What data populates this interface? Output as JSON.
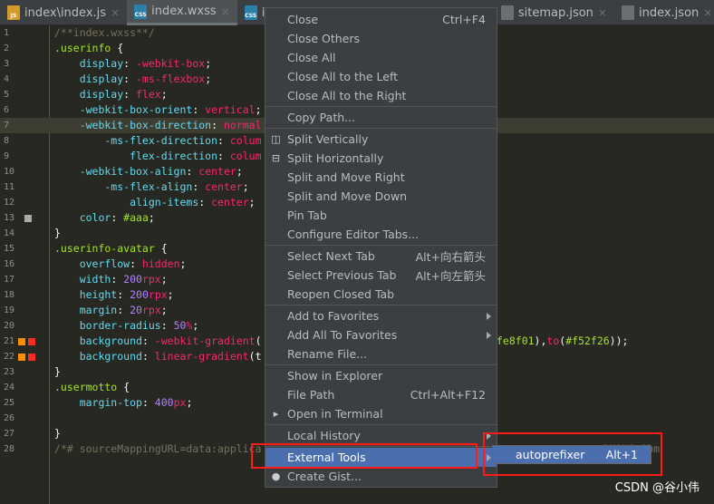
{
  "tabs": [
    {
      "label": "index\\index.js",
      "icon": "js-file-icon",
      "badge": "JS",
      "active": false
    },
    {
      "label": "index.wxss",
      "icon": "css-file-icon",
      "badge": "CSS",
      "active": true
    },
    {
      "label": "ind",
      "icon": "css-file-icon",
      "badge": "CSS",
      "active": false
    },
    {
      "label": "sitemap.json",
      "icon": "json-file-icon",
      "badge": "",
      "active": false
    },
    {
      "label": "index.json",
      "icon": "json-file-icon",
      "badge": "",
      "active": false
    }
  ],
  "editor": {
    "current_line": 7,
    "lines": [
      {
        "n": "1",
        "seg": [
          [
            "comment",
            "/**index.wxss**/"
          ]
        ]
      },
      {
        "n": "2",
        "seg": [
          [
            "sel",
            ".userinfo "
          ],
          [
            "p",
            "{"
          ]
        ]
      },
      {
        "n": "3",
        "seg": [
          [
            "prop",
            "    display"
          ],
          [
            "p",
            ": "
          ],
          [
            "val",
            "-webkit-box"
          ],
          [
            "p",
            ";"
          ]
        ]
      },
      {
        "n": "4",
        "seg": [
          [
            "prop",
            "    display"
          ],
          [
            "p",
            ": "
          ],
          [
            "val",
            "-ms-flexbox"
          ],
          [
            "p",
            ";"
          ]
        ]
      },
      {
        "n": "5",
        "seg": [
          [
            "prop",
            "    display"
          ],
          [
            "p",
            ": "
          ],
          [
            "val",
            "flex"
          ],
          [
            "p",
            ";"
          ]
        ]
      },
      {
        "n": "6",
        "seg": [
          [
            "prop",
            "    -webkit-box-orient"
          ],
          [
            "p",
            ": "
          ],
          [
            "val",
            "vertical"
          ],
          [
            "p",
            ";"
          ]
        ]
      },
      {
        "n": "7",
        "seg": [
          [
            "prop",
            "    -webkit-box-direction"
          ],
          [
            "p",
            ": "
          ],
          [
            "val",
            "normal"
          ]
        ]
      },
      {
        "n": "8",
        "seg": [
          [
            "prop",
            "        -ms-flex-direction"
          ],
          [
            "p",
            ": "
          ],
          [
            "val",
            "colum"
          ]
        ]
      },
      {
        "n": "9",
        "seg": [
          [
            "prop",
            "            flex-direction"
          ],
          [
            "p",
            ": "
          ],
          [
            "val",
            "colum"
          ]
        ]
      },
      {
        "n": "10",
        "seg": [
          [
            "prop",
            "    -webkit-box-align"
          ],
          [
            "p",
            ": "
          ],
          [
            "val",
            "center"
          ],
          [
            "p",
            ";"
          ]
        ]
      },
      {
        "n": "11",
        "seg": [
          [
            "prop",
            "        -ms-flex-align"
          ],
          [
            "p",
            ": "
          ],
          [
            "val",
            "center"
          ],
          [
            "p",
            ";"
          ]
        ]
      },
      {
        "n": "12",
        "seg": [
          [
            "prop",
            "            align-items"
          ],
          [
            "p",
            ": "
          ],
          [
            "val",
            "center"
          ],
          [
            "p",
            ";"
          ]
        ]
      },
      {
        "n": "13",
        "seg": [
          [
            "prop",
            "    color"
          ],
          [
            "p",
            ": "
          ],
          [
            "sel",
            "#aaa"
          ],
          [
            "p",
            ";"
          ]
        ],
        "marks": [
          "#aaaaaa"
        ]
      },
      {
        "n": "14",
        "seg": [
          [
            "p",
            "}"
          ]
        ]
      },
      {
        "n": "15",
        "seg": [
          [
            "sel",
            ".userinfo-avatar "
          ],
          [
            "p",
            "{"
          ]
        ]
      },
      {
        "n": "16",
        "seg": [
          [
            "prop",
            "    overflow"
          ],
          [
            "p",
            ": "
          ],
          [
            "val",
            "hidden"
          ],
          [
            "p",
            ";"
          ]
        ]
      },
      {
        "n": "17",
        "seg": [
          [
            "prop",
            "    width"
          ],
          [
            "p",
            ": "
          ],
          [
            "num",
            "200"
          ],
          [
            "val",
            "rpx"
          ],
          [
            "p",
            ";"
          ]
        ]
      },
      {
        "n": "18",
        "seg": [
          [
            "prop",
            "    height"
          ],
          [
            "p",
            ": "
          ],
          [
            "num",
            "200"
          ],
          [
            "val",
            "rpx"
          ],
          [
            "p",
            ";"
          ]
        ]
      },
      {
        "n": "19",
        "seg": [
          [
            "prop",
            "    margin"
          ],
          [
            "p",
            ": "
          ],
          [
            "num",
            "20"
          ],
          [
            "val",
            "rpx"
          ],
          [
            "p",
            ";"
          ]
        ]
      },
      {
        "n": "20",
        "seg": [
          [
            "prop",
            "    border-radius"
          ],
          [
            "p",
            ": "
          ],
          [
            "num",
            "50"
          ],
          [
            "val",
            "%"
          ],
          [
            "p",
            ";"
          ]
        ]
      },
      {
        "n": "21",
        "seg": [
          [
            "prop",
            "    background"
          ],
          [
            "p",
            ": "
          ],
          [
            "val",
            "-webkit-gradient"
          ],
          [
            "p",
            "("
          ]
        ],
        "tail": [
          [
            "sel",
            "fe8f01"
          ],
          [
            "p",
            "),"
          ],
          [
            "val",
            "to"
          ],
          [
            "p",
            "("
          ],
          [
            "sel",
            "#f52f26"
          ],
          [
            "p",
            "));"
          ]
        ],
        "marks": [
          "#fe8f01",
          "#f52f26"
        ]
      },
      {
        "n": "22",
        "seg": [
          [
            "prop",
            "    background"
          ],
          [
            "p",
            ": "
          ],
          [
            "val",
            "linear-gradient"
          ],
          [
            "p",
            "(t"
          ]
        ],
        "marks": [
          "#fe8f01",
          "#f52f26"
        ]
      },
      {
        "n": "23",
        "seg": [
          [
            "p",
            "}"
          ]
        ]
      },
      {
        "n": "24",
        "seg": [
          [
            "sel",
            ".usermotto "
          ],
          [
            "p",
            "{"
          ]
        ]
      },
      {
        "n": "25",
        "seg": [
          [
            "prop",
            "    margin-top"
          ],
          [
            "p",
            ": "
          ],
          [
            "num",
            "400"
          ],
          [
            "val",
            "px"
          ],
          [
            "p",
            ";"
          ]
        ]
      },
      {
        "n": "26",
        "seg": []
      },
      {
        "n": "27",
        "seg": [
          [
            "p",
            "}"
          ]
        ]
      },
      {
        "n": "28",
        "seg": [
          [
            "comment",
            "/*# sourceMappingURL=data:applica"
          ]
        ],
        "tail": [
          [
            "comment",
            "                c3MiXSwibm"
          ]
        ]
      }
    ]
  },
  "context_menu": {
    "items": [
      {
        "label": "Close",
        "shortcut": "Ctrl+F4"
      },
      {
        "label": "Close Others"
      },
      {
        "label": "Close All"
      },
      {
        "label": "Close All to the Left"
      },
      {
        "label": "Close All to the Right"
      },
      {
        "sep": true
      },
      {
        "label": "Copy Path..."
      },
      {
        "sep": true
      },
      {
        "label": "Split Vertically",
        "icon": "split-vertical-icon"
      },
      {
        "label": "Split Horizontally",
        "icon": "split-horizontal-icon"
      },
      {
        "label": "Split and Move Right"
      },
      {
        "label": "Split and Move Down"
      },
      {
        "label": "Pin Tab"
      },
      {
        "label": "Configure Editor Tabs..."
      },
      {
        "sep": true
      },
      {
        "label": "Select Next Tab",
        "shortcut": "Alt+向右箭头"
      },
      {
        "label": "Select Previous Tab",
        "shortcut": "Alt+向左箭头"
      },
      {
        "label": "Reopen Closed Tab"
      },
      {
        "sep": true
      },
      {
        "label": "Add to Favorites",
        "submenu": true
      },
      {
        "label": "Add All To Favorites",
        "submenu": true
      },
      {
        "label": "Rename File..."
      },
      {
        "sep": true
      },
      {
        "label": "Show in Explorer"
      },
      {
        "label": "File Path",
        "shortcut": "Ctrl+Alt+F12"
      },
      {
        "label": "Open in Terminal",
        "icon": "terminal-icon"
      },
      {
        "sep": true
      },
      {
        "label": "Local History",
        "submenu": true
      },
      {
        "sep": true
      },
      {
        "label": "External Tools",
        "submenu": true,
        "highlighted": true
      },
      {
        "label": "Create Gist...",
        "icon": "github-icon"
      }
    ]
  },
  "submenu": {
    "label": "autoprefixer",
    "shortcut": "Alt+1"
  },
  "watermark": "CSDN @谷小伟",
  "colors": {
    "highlight": "#4b6eaf",
    "annotation_box": "#ff1a1a"
  }
}
